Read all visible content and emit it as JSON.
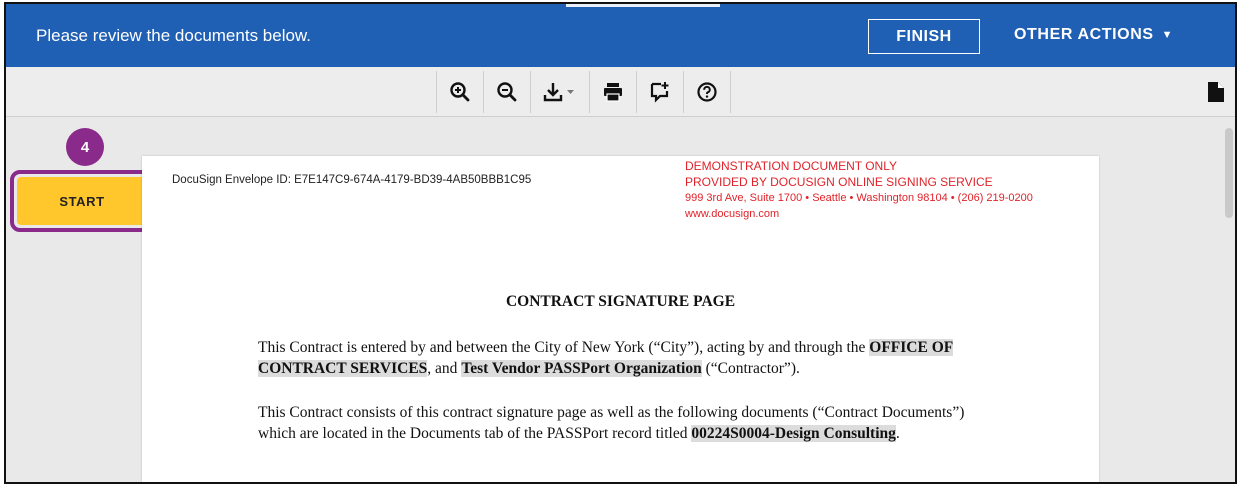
{
  "header": {
    "message": "Please review the documents below.",
    "finish_label": "FINISH",
    "other_actions_label": "OTHER ACTIONS",
    "caret": "▼"
  },
  "toolbar": {
    "tools": [
      "zoom-in-icon",
      "zoom-out-icon",
      "download-icon",
      "print-icon",
      "comment-icon",
      "help-icon"
    ],
    "right_icon": "document-icon"
  },
  "step": {
    "badge": "4",
    "start_label": "START"
  },
  "document": {
    "envelope_id": "DocuSign Envelope ID: E7E147C9-674A-4179-BD39-4AB50BBB1C95",
    "demo_line1": "DEMONSTRATION DOCUMENT ONLY",
    "demo_line2": "PROVIDED BY DOCUSIGN ONLINE SIGNING SERVICE",
    "demo_line3": "999 3rd Ave, Suite 1700  • Seattle • Washington 98104 • (206) 219-0200",
    "demo_line4": "www.docusign.com",
    "title": "CONTRACT SIGNATURE PAGE",
    "p1_a": "This Contract is entered by and between the City of New York (“City”), acting by and through the",
    "p1_hl1": "OFFICE OF CONTRACT SERVICES",
    "p1_b": ", and ",
    "p1_hl2": "Test Vendor PASSPort Organization",
    "p1_c": " (“Contractor”).",
    "p2_a": "This Contract consists of this contract signature page as well as the following documents (“Contract Documents”) which are located in the Documents tab of the PASSPort record titled ",
    "p2_hl": "00224S0004-Design Consulting",
    "p2_b": "."
  },
  "colors": {
    "header_blue": "#1f5fb4",
    "start_yellow": "#ffc72c",
    "highlight_purple": "#8a2a8b",
    "demo_red": "#e0232b"
  }
}
